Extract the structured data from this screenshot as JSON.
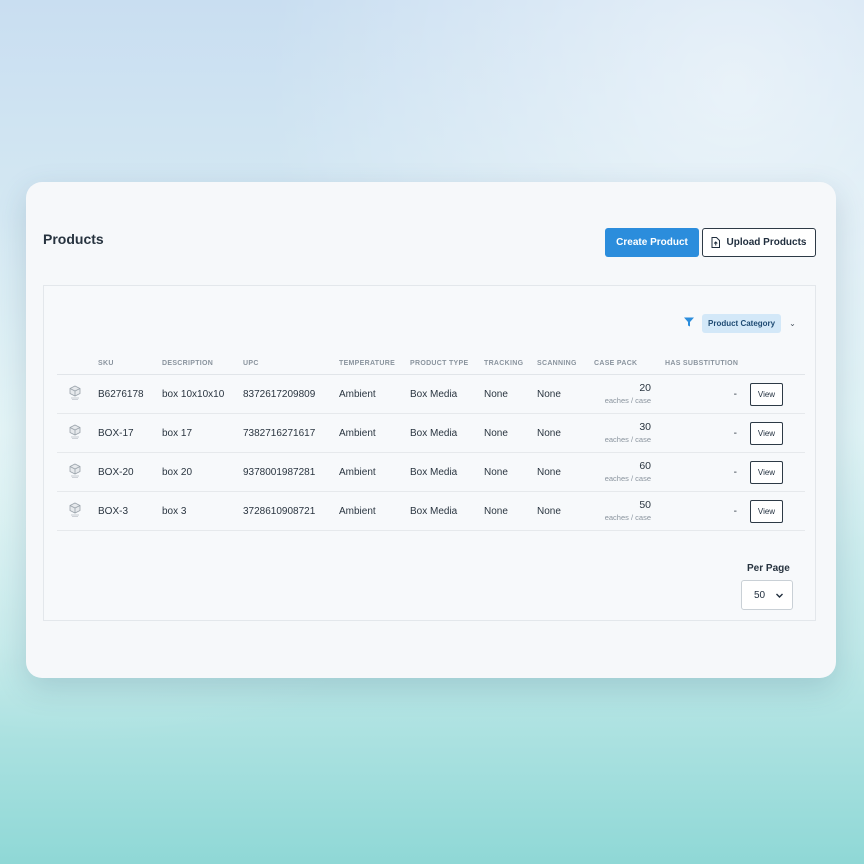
{
  "page": {
    "title": "Products"
  },
  "actions": {
    "create_label": "Create Product",
    "upload_label": "Upload Products",
    "upload_icon": "file-upload-icon"
  },
  "filter": {
    "icon": "filter-icon",
    "category_label": "Product Category",
    "chevron": "⌄"
  },
  "table": {
    "columns": {
      "sku": "SKU",
      "description": "DESCRIPTION",
      "upc": "UPC",
      "temperature": "TEMPERATURE",
      "product_type": "PRODUCT TYPE",
      "tracking": "TRACKING",
      "scanning": "SCANNING",
      "case_pack": "CASE PACK",
      "has_substitution": "HAS SUBSTITUTION"
    },
    "row_icon": "box-icon",
    "rows": [
      {
        "sku": "B6276178",
        "description": "box 10x10x10",
        "upc": "8372617209809",
        "temperature": "Ambient",
        "product_type": "Box Media",
        "tracking": "None",
        "scanning": "None",
        "case_pack": "20",
        "case_unit": "eaches / case",
        "has_substitution": "-",
        "action": "View"
      },
      {
        "sku": "BOX-17",
        "description": "box 17",
        "upc": "7382716271617",
        "temperature": "Ambient",
        "product_type": "Box Media",
        "tracking": "None",
        "scanning": "None",
        "case_pack": "30",
        "case_unit": "eaches / case",
        "has_substitution": "-",
        "action": "View"
      },
      {
        "sku": "BOX-20",
        "description": "box 20",
        "upc": "9378001987281",
        "temperature": "Ambient",
        "product_type": "Box Media",
        "tracking": "None",
        "scanning": "None",
        "case_pack": "60",
        "case_unit": "eaches / case",
        "has_substitution": "-",
        "action": "View"
      },
      {
        "sku": "BOX-3",
        "description": "box 3",
        "upc": "3728610908721",
        "temperature": "Ambient",
        "product_type": "Box Media",
        "tracking": "None",
        "scanning": "None",
        "case_pack": "50",
        "case_unit": "eaches / case",
        "has_substitution": "-",
        "action": "View"
      }
    ]
  },
  "pagination": {
    "per_page_label": "Per Page",
    "per_page_value": "50"
  },
  "colors": {
    "primary": "#2b8ddc",
    "pill_bg": "#d3e8f8"
  }
}
